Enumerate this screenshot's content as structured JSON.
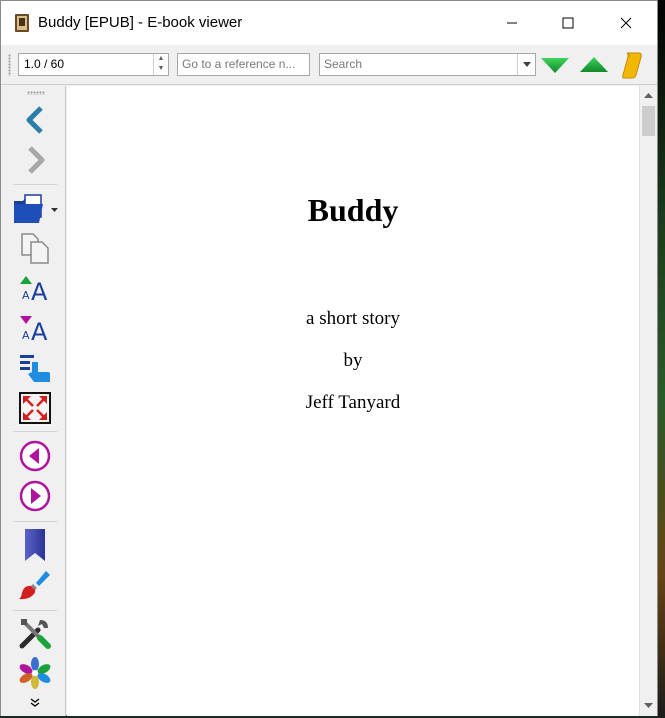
{
  "window": {
    "title": "Buddy [EPUB] - E-book viewer"
  },
  "toolbar": {
    "position_value": "1.0 / 60",
    "reference_placeholder": "Go to a reference n...",
    "search_placeholder": "Search"
  },
  "sidebar": {
    "items": [
      {
        "name": "back-icon"
      },
      {
        "name": "forward-icon"
      },
      {
        "name": "open-book-icon"
      },
      {
        "name": "copy-icon"
      },
      {
        "name": "font-size-larger-icon"
      },
      {
        "name": "font-size-smaller-icon"
      },
      {
        "name": "table-of-contents-icon"
      },
      {
        "name": "fullscreen-icon"
      },
      {
        "name": "previous-page-icon"
      },
      {
        "name": "next-page-icon"
      },
      {
        "name": "bookmark-icon"
      },
      {
        "name": "theme-brush-icon"
      },
      {
        "name": "preferences-icon"
      },
      {
        "name": "calibre-logo-icon"
      },
      {
        "name": "more-chevron-icon"
      }
    ]
  },
  "book": {
    "title": "Buddy",
    "subtitle": "a short story",
    "by": "by",
    "author": "Jeff Tanyard"
  },
  "colors": {
    "accent_green": "#1aa33a",
    "nav_teal": "#2a7fa8",
    "magenta": "#b0139e"
  }
}
